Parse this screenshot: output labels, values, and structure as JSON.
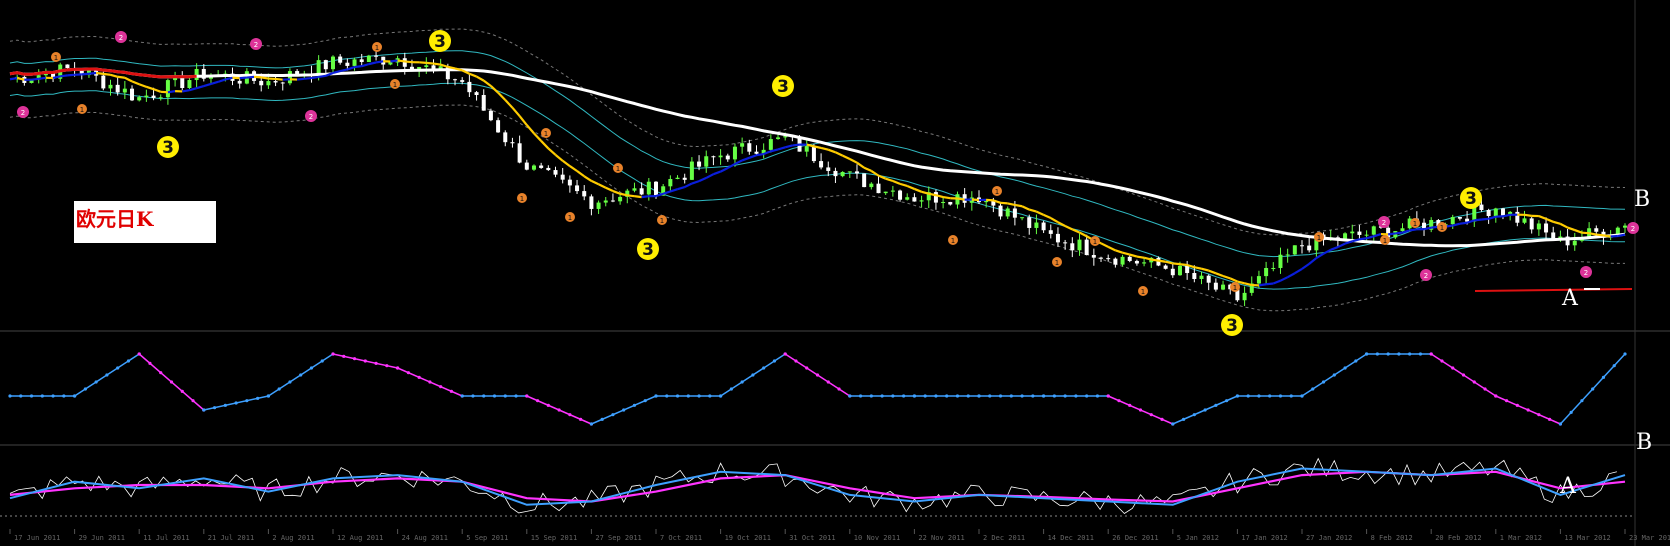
{
  "annotation": {
    "label": "欧元日K"
  },
  "markers": {
    "b_main": "B",
    "a_main": "A",
    "b_osc": "B",
    "a_osc": "A",
    "wave3": "3",
    "wave1": "1",
    "wave2": "2"
  },
  "colors": {
    "background": "#000000",
    "candle_up": "#66ff44",
    "candle_down": "#ffffff",
    "ma_fast": "#ffcc00",
    "ma_blue": "#0a1edc",
    "ma_long": "#ffffff",
    "ma_long_tail": "#dd1111",
    "envelope": "#30b8c0",
    "bollinger": "#777777",
    "zigzag_up": "#3ea0ff",
    "zigzag_down": "#ff33ff",
    "osc_fast": "#3ea0ff",
    "osc_slow": "#ff33ff",
    "osc_raw": "#ffffff",
    "wave3_fill": "#ffee00",
    "wave1_fill": "#e8822a",
    "wave2_fill": "#dd3399"
  },
  "chart_data": [
    {
      "type": "candlestick",
      "panel": "price",
      "label": "欧元日K",
      "x": [
        "17 Jun 2011",
        "29 Jun 2011",
        "11 Jul 2011",
        "21 Jul 2011",
        "2 Aug 2011",
        "12 Aug 2011",
        "24 Aug 2011",
        "5 Sep 2011",
        "15 Sep 2011",
        "27 Sep 2011",
        "7 Oct 2011",
        "19 Oct 2011",
        "31 Oct 2011",
        "10 Nov 2011",
        "22 Nov 2011",
        "2 Dec 2011",
        "14 Dec 2011",
        "26 Dec 2011",
        "5 Jan 2012",
        "17 Jan 2012",
        "27 Jan 2012",
        "8 Feb 2012",
        "20 Feb 2012",
        "1 Mar 2012",
        "13 Mar 2012",
        "23 Mar 2012"
      ],
      "close": [
        1.432,
        1.44,
        1.418,
        1.436,
        1.43,
        1.444,
        1.448,
        1.43,
        1.368,
        1.342,
        1.352,
        1.376,
        1.388,
        1.36,
        1.345,
        1.346,
        1.318,
        1.302,
        1.292,
        1.27,
        1.31,
        1.318,
        1.326,
        1.338,
        1.312,
        1.324
      ],
      "ylim": [
        1.25,
        1.48
      ]
    },
    {
      "type": "line",
      "panel": "zigzag",
      "x": [
        "17 Jun 2011",
        "29 Jun 2011",
        "11 Jul 2011",
        "21 Jul 2011",
        "2 Aug 2011",
        "12 Aug 2011",
        "24 Aug 2011",
        "5 Sep 2011",
        "15 Sep 2011",
        "27 Sep 2011",
        "7 Oct 2011",
        "19 Oct 2011",
        "31 Oct 2011",
        "10 Nov 2011",
        "22 Nov 2011",
        "2 Dec 2011",
        "14 Dec 2011",
        "26 Dec 2011",
        "5 Jan 2012",
        "17 Jan 2012",
        "27 Jan 2012",
        "8 Feb 2012",
        "20 Feb 2012",
        "1 Mar 2012",
        "13 Mar 2012",
        "23 Mar 2012"
      ],
      "values": [
        0,
        0,
        3,
        -1,
        0,
        3,
        2,
        0,
        0,
        -2,
        0,
        0,
        3,
        0,
        0,
        0,
        0,
        0,
        -2,
        0,
        0,
        3,
        3,
        0,
        -2,
        3
      ],
      "ylim": [
        -3,
        4
      ]
    },
    {
      "type": "line",
      "panel": "oscillator",
      "x": [
        "17 Jun 2011",
        "29 Jun 2011",
        "11 Jul 2011",
        "21 Jul 2011",
        "2 Aug 2011",
        "12 Aug 2011",
        "24 Aug 2011",
        "5 Sep 2011",
        "15 Sep 2011",
        "27 Sep 2011",
        "7 Oct 2011",
        "19 Oct 2011",
        "31 Oct 2011",
        "10 Nov 2011",
        "22 Nov 2011",
        "2 Dec 2011",
        "14 Dec 2011",
        "26 Dec 2011",
        "5 Jan 2012",
        "17 Jan 2012",
        "27 Jan 2012",
        "8 Feb 2012",
        "20 Feb 2012",
        "1 Mar 2012",
        "13 Mar 2012",
        "23 Mar 2012"
      ],
      "series": [
        {
          "values": [
            0.3,
            0.55,
            0.45,
            0.6,
            0.4,
            0.6,
            0.65,
            0.55,
            0.2,
            0.25,
            0.5,
            0.7,
            0.65,
            0.35,
            0.25,
            0.35,
            0.3,
            0.25,
            0.2,
            0.55,
            0.75,
            0.7,
            0.65,
            0.75,
            0.35,
            0.65
          ]
        },
        {
          "values": [
            0.35,
            0.45,
            0.5,
            0.5,
            0.45,
            0.55,
            0.6,
            0.55,
            0.3,
            0.25,
            0.4,
            0.6,
            0.65,
            0.45,
            0.3,
            0.35,
            0.32,
            0.28,
            0.25,
            0.45,
            0.65,
            0.7,
            0.65,
            0.7,
            0.45,
            0.55
          ]
        }
      ],
      "ylim": [
        0,
        1
      ]
    }
  ]
}
